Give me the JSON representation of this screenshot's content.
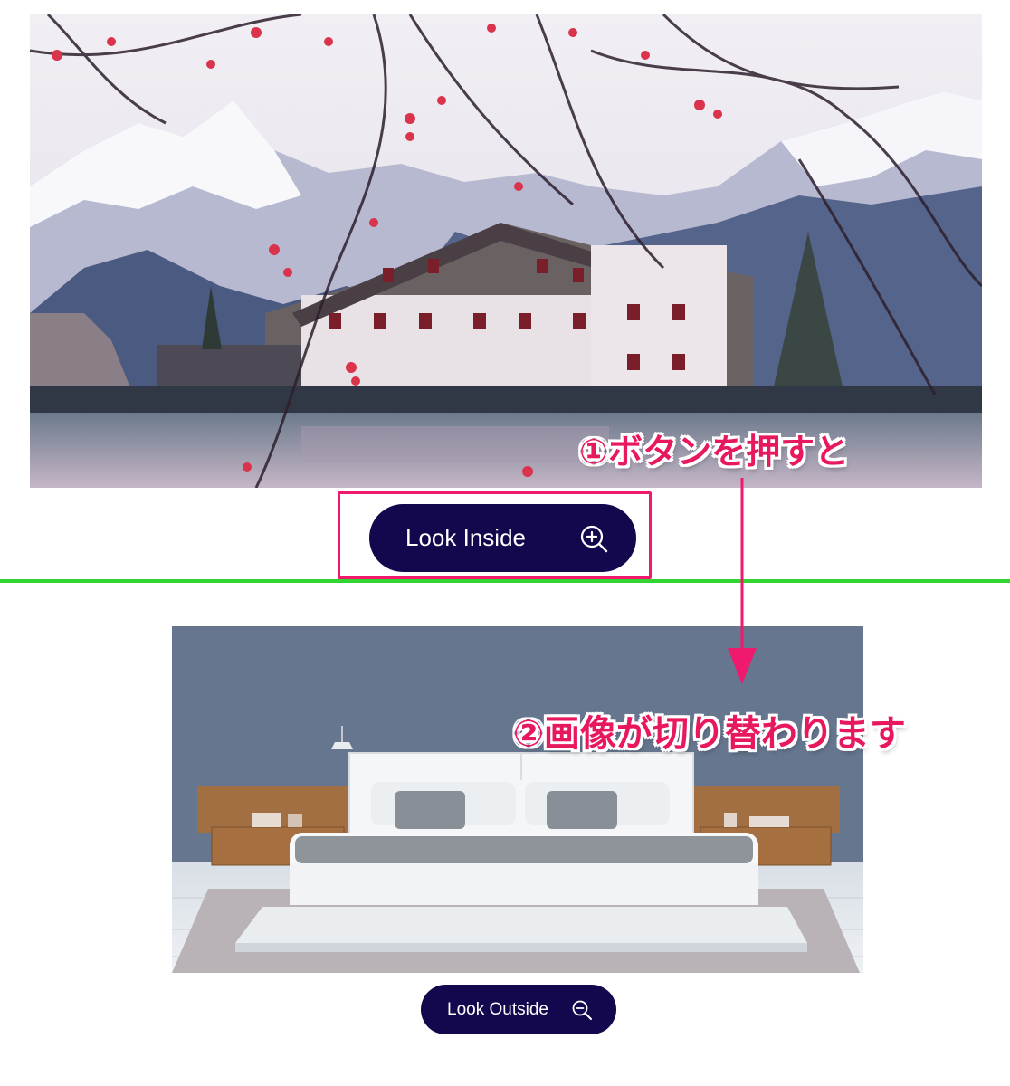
{
  "buttons": {
    "look_inside": "Look Inside",
    "look_outside": "Look Outside"
  },
  "annotations": {
    "step1": "①ボタンを押すと",
    "step2": "②画像が切り替わります"
  },
  "icons": {
    "zoom_in": "zoom-in-icon",
    "zoom_out": "zoom-out-icon",
    "arrow": "arrow-down-icon"
  },
  "colors": {
    "button_bg": "#13084d",
    "highlight": "#ef1a6d",
    "annotation_text": "#e8185f",
    "divider": "#33d533"
  }
}
